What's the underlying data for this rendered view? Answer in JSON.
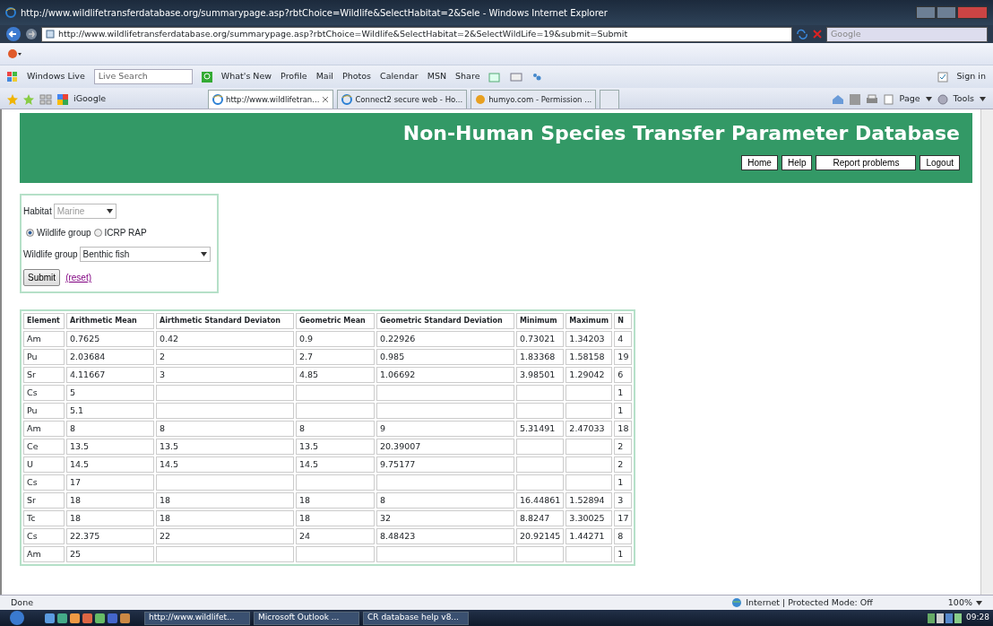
{
  "window": {
    "title": "http://www.wildlifetransferdatabase.org/summarypage.asp?rbtChoice=Wildlife&SelectHabitat=2&Sele - Windows Internet Explorer"
  },
  "address_bar": {
    "url": "http://www.wildlifetransferdatabase.org/summarypage.asp?rbtChoice=Wildlife&SelectHabitat=2&SelectWildLife=19&submit=Submit",
    "search_placeholder": "Google"
  },
  "links_bar": {
    "brand": "Windows Live",
    "search_placeholder": "Live Search",
    "links": [
      "What's New",
      "Profile",
      "Mail",
      "Photos",
      "Calendar",
      "MSN",
      "Share"
    ],
    "sign_in": "Sign in"
  },
  "favorites": {
    "item": "iGoogle"
  },
  "tabs": [
    {
      "label": "http://www.wildlifetran...",
      "selected": true
    },
    {
      "label": "Connect2 secure web - Ho...",
      "selected": false
    },
    {
      "label": "humyo.com - Permission ...",
      "selected": false
    }
  ],
  "command_bar": [
    "Page",
    "Tools"
  ],
  "page": {
    "title": "Non-Human Species Transfer Parameter Database",
    "nav": [
      "Home",
      "Help",
      "Report problems",
      "Logout"
    ],
    "form": {
      "habitat_label": "Habitat",
      "habitat_value": "Marine",
      "habitat_disabled": true,
      "radios": [
        {
          "label": "Wildlife group",
          "selected": true
        },
        {
          "label": "ICRP RAP",
          "selected": false
        }
      ],
      "group_label": "Wildlife group",
      "group_value": "Benthic fish",
      "submit": "Submit",
      "reset": "(reset)"
    },
    "table": {
      "columns": [
        "Element",
        "Arithmetic Mean",
        "Airthmetic Standard Deviaton",
        "Geometric Mean",
        "Geometric Standard Deviation",
        "Minimum",
        "Maximum",
        "N"
      ],
      "rows": [
        [
          "Am",
          "0.7625",
          "0.42",
          "0.9",
          "0.22926",
          "0.73021",
          "1.34203",
          "4"
        ],
        [
          "Pu",
          "2.03684",
          "2",
          "2.7",
          "0.985",
          "1.83368",
          "1.58158",
          "19"
        ],
        [
          "Sr",
          "4.11667",
          "3",
          "4.85",
          "1.06692",
          "3.98501",
          "1.29042",
          "6"
        ],
        [
          "Cs",
          "5",
          "",
          "",
          "",
          "",
          "",
          "1"
        ],
        [
          "Pu",
          "5.1",
          "",
          "",
          "",
          "",
          "",
          "1"
        ],
        [
          "Am",
          "8",
          "8",
          "8",
          "9",
          "5.31491",
          "2.47033",
          "18"
        ],
        [
          "Ce",
          "13.5",
          "13.5",
          "13.5",
          "20.39007",
          "",
          "",
          "2"
        ],
        [
          "U",
          "14.5",
          "14.5",
          "14.5",
          "9.75177",
          "",
          "",
          "2"
        ],
        [
          "Cs",
          "17",
          "",
          "",
          "",
          "",
          "",
          "1"
        ],
        [
          "Sr",
          "18",
          "18",
          "18",
          "8",
          "16.44861",
          "1.52894",
          "3"
        ],
        [
          "Tc",
          "18",
          "18",
          "18",
          "32",
          "8.8247",
          "3.30025",
          "17"
        ],
        [
          "Cs",
          "22.375",
          "22",
          "24",
          "8.48423",
          "20.92145",
          "1.44271",
          "8"
        ],
        [
          "Am",
          "25",
          "",
          "",
          "",
          "",
          "",
          "1"
        ]
      ]
    }
  },
  "status_bar": {
    "text": "Done",
    "zone": "Internet | Protected Mode: Off",
    "zoom": "100%"
  },
  "taskbar": {
    "items": [
      "http://www.wildlifet...",
      "Microsoft Outlook ...",
      "CR database help v8..."
    ],
    "clock": "09:28"
  }
}
